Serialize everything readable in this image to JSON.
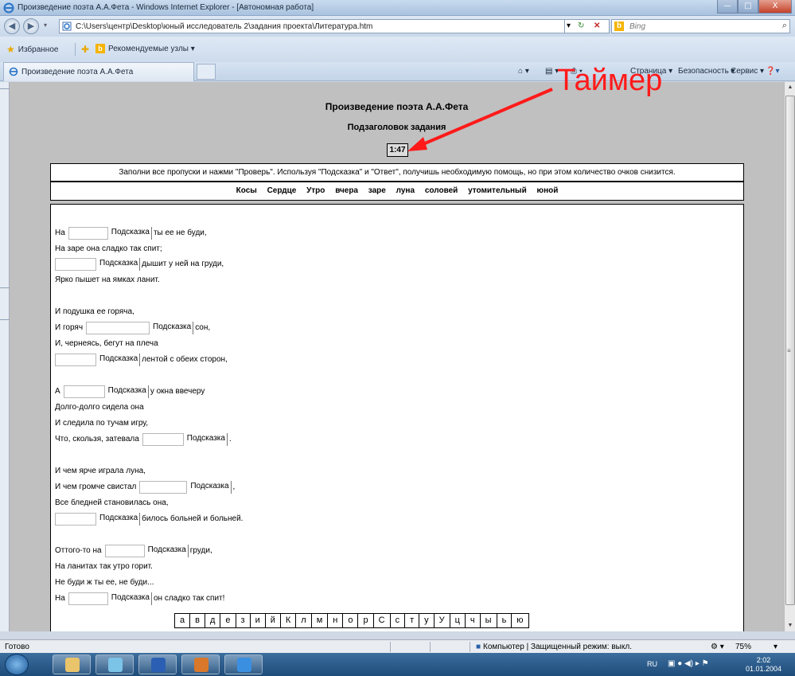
{
  "window": {
    "title": "Произведение поэта А.А.Фета - Windows Internet Explorer - [Автономная работа]",
    "controls": [
      "—",
      "□",
      "X"
    ]
  },
  "address": {
    "url": "C:\\Users\\центр\\Desktop\\юный исследователь 2\\задания проекта\\Литература.htm",
    "search_placeholder": "Bing"
  },
  "favorites": {
    "favorites_label": "Избранное",
    "suggested_label": "Рекомендуемые узлы ▾"
  },
  "tab": {
    "label": "Произведение поэта А.А.Фета"
  },
  "commands": {
    "page": "Страница ▾",
    "security": "Безопасность ▾",
    "service": "Сервис ▾"
  },
  "page": {
    "title": "Произведение поэта А.А.Фета",
    "subtitle": "Подзаголовок задания",
    "timer": "1:47",
    "instructions": "Заполни все пропуски и нажми \"Проверь\". Используя \"Подсказка\" и \"Ответ\", получишь необходимую помощь, но при этом количество очков снизится.",
    "word_bank": [
      "Косы",
      "Сердце",
      "Утро",
      "вчера",
      "заре",
      "луна",
      "соловей",
      "утомительный",
      "юной"
    ],
    "hint_label": "Подсказка",
    "poem_lines": [
      {
        "before": "На",
        "gap": true,
        "after": "ты ее не буди,"
      },
      {
        "before": "На заре она сладко так спит;",
        "gap": false,
        "after": ""
      },
      {
        "before": "",
        "gap": true,
        "after": "дышит у ней на груди,"
      },
      {
        "before": "Ярко пышет на ямках ланит.",
        "gap": false,
        "after": ""
      },
      {
        "before": "И подушка ее горяча,",
        "gap": false,
        "after": ""
      },
      {
        "before": "И горяч",
        "gap": true,
        "after": "сон,"
      },
      {
        "before": "И, чернеясь, бегут на плеча",
        "gap": false,
        "after": ""
      },
      {
        "before": "",
        "gap": true,
        "after": "лентой с обеих сторон,"
      },
      {
        "before": "А",
        "gap": true,
        "after": "у окна ввечеру"
      },
      {
        "before": "Долго-долго сидела она",
        "gap": false,
        "after": ""
      },
      {
        "before": "И следила по тучам игру,",
        "gap": false,
        "after": ""
      },
      {
        "before": "Что, скользя, затевала",
        "gap": true,
        "after": "."
      },
      {
        "before": "И чем ярче играла луна,",
        "gap": false,
        "after": ""
      },
      {
        "before": "И чем громче свистал",
        "gap": true,
        "after": ","
      },
      {
        "before": "Все бледней становилась она,",
        "gap": false,
        "after": ""
      },
      {
        "before": "",
        "gap": true,
        "after": "билось больней и больней."
      },
      {
        "before": "Оттого-то на",
        "gap": true,
        "after": "груди,"
      },
      {
        "before": "На ланитах так утро горит.",
        "gap": false,
        "after": ""
      },
      {
        "before": "Не буди ж ты ее, не буди...",
        "gap": false,
        "after": ""
      },
      {
        "before": "На",
        "gap": true,
        "after": "он сладко так спит!"
      }
    ],
    "alphabet": [
      "а",
      "в",
      "д",
      "е",
      "з",
      "и",
      "й",
      "К",
      "л",
      "м",
      "н",
      "о",
      "р",
      "С",
      "с",
      "т",
      "у",
      "У",
      "ц",
      "ч",
      "ы",
      "ь",
      "ю"
    ]
  },
  "annotation": {
    "label": "Таймер",
    "color": "#ff1a1a"
  },
  "status": {
    "text": "Готово",
    "zone": "Компьютер | Защищенный режим: выкл.",
    "zoom": "75%"
  },
  "taskbar": {
    "lang": "RU",
    "time": "2:02",
    "date": "01.01.2004"
  }
}
